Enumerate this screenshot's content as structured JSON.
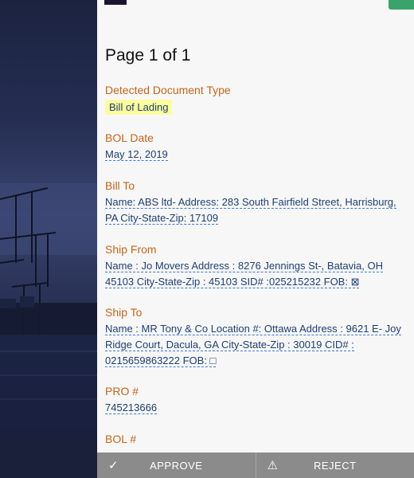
{
  "document": {
    "page_label": "Page 1 of 1",
    "fields": [
      {
        "label": "Detected Document Type",
        "value": "Bill of Lading"
      },
      {
        "label": "BOL Date",
        "value": "May 12, 2019"
      },
      {
        "label": "Bill To",
        "value": "Name: ABS ltd- Address: 283 South Fairfield Street, Harrisburg, PA City-State-Zip: 17109"
      },
      {
        "label": "Ship From",
        "value": "Name : Jo Movers Address : 8276 Jennings St-, Batavia, OH 45103 City-State-Zip : 45103 SID# :025215232 FOB: ⊠"
      },
      {
        "label": "Ship To",
        "value": "Name : MR Tony & Co Location #: Ottawa Address : 9621 E- Joy Ridge Court, Dacula, GA City-State-Zip : 30019 CID# : 0215659863222 FOB: □"
      },
      {
        "label": "PRO #",
        "value": "745213666"
      },
      {
        "label": "BOL #",
        "value": ""
      }
    ]
  },
  "footer": {
    "approve_label": "APPROVE",
    "reject_label": "REJECT",
    "approve_icon": "checkmark-icon",
    "reject_icon": "warning-icon"
  },
  "colors": {
    "label": "#c0661a",
    "value": "#1f3f6e",
    "highlight": "#fbfd9f",
    "footer": "#8b8b8b"
  }
}
